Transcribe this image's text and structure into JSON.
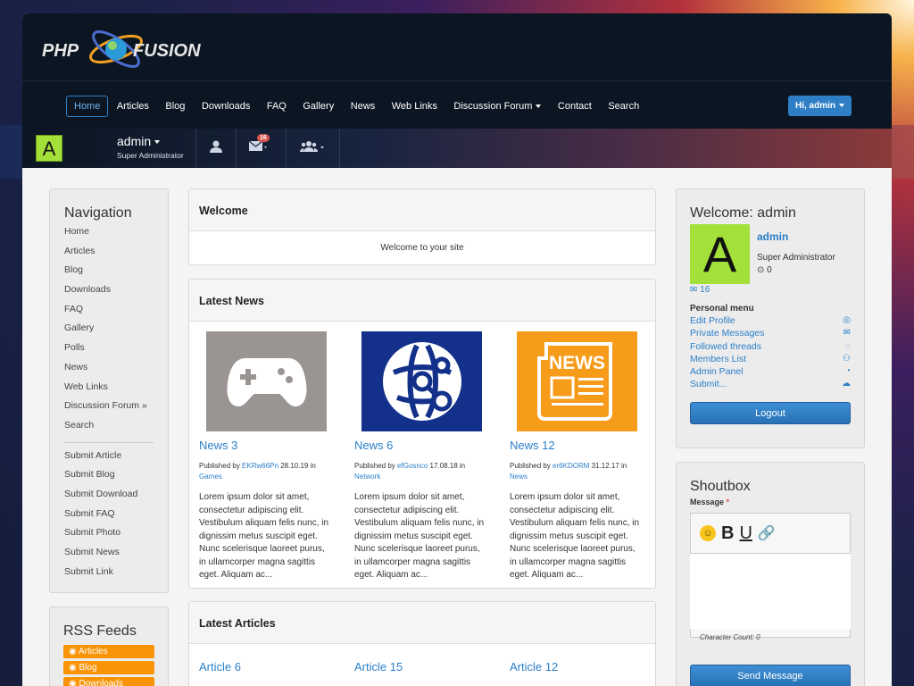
{
  "brand": {
    "logo_text": "PHP FUSION",
    "accent": "#2a7fc9",
    "avatar_color": "#a3e03a"
  },
  "topnav": {
    "items": [
      "Home",
      "Articles",
      "Blog",
      "Downloads",
      "FAQ",
      "Gallery",
      "News",
      "Web Links",
      "Discussion Forum",
      "Contact",
      "Search"
    ],
    "active": "Home",
    "user_button": "Hi, admin"
  },
  "userbar": {
    "avatar_letter": "A",
    "name": "admin",
    "role": "Super Administrator",
    "messages_count": "16"
  },
  "navigation": {
    "title": "Navigation",
    "items": [
      "Home",
      "Articles",
      "Blog",
      "Downloads",
      "FAQ",
      "Gallery",
      "Polls",
      "News",
      "Web Links",
      "Discussion Forum »",
      "Search"
    ],
    "submit_items": [
      "Submit Article",
      "Submit Blog",
      "Submit Download",
      "Submit FAQ",
      "Submit Photo",
      "Submit News",
      "Submit Link"
    ]
  },
  "rss": {
    "title": "RSS Feeds",
    "items": [
      "Articles",
      "Blog",
      "Downloads"
    ]
  },
  "welcome_panel": {
    "title": "Welcome",
    "text": "Welcome to your site"
  },
  "latest_news": {
    "title": "Latest News",
    "items": [
      {
        "title": "News 3",
        "published_by": "Published by",
        "author": "EKRw66Pn",
        "date": "28.10.19",
        "in": "in",
        "category": "Games",
        "icon": "gamepad-icon",
        "body": "Lorem ipsum dolor sit amet, consectetur adipiscing elit. Vestibulum aliquam felis nunc, in dignissim metus suscipit eget. Nunc scelerisque laoreet purus, in ullamcorper magna sagittis eget. Aliquam ac..."
      },
      {
        "title": "News 6",
        "published_by": "Published by",
        "author": "efGosnco",
        "date": "17.08.18",
        "in": "in",
        "category": "Network",
        "icon": "network-globe-icon",
        "body": "Lorem ipsum dolor sit amet, consectetur adipiscing elit. Vestibulum aliquam felis nunc, in dignissim metus suscipit eget. Nunc scelerisque laoreet purus, in ullamcorper magna sagittis eget. Aliquam ac..."
      },
      {
        "title": "News 12",
        "published_by": "Published by",
        "author": "er6KDORM",
        "date": "31.12.17",
        "in": "in",
        "category": "News",
        "icon": "newspaper-icon",
        "body": "Lorem ipsum dolor sit amet, consectetur adipiscing elit. Vestibulum aliquam felis nunc, in dignissim metus suscipit eget. Nunc scelerisque laoreet purus, in ullamcorper magna sagittis eget. Aliquam ac..."
      }
    ]
  },
  "latest_articles": {
    "title": "Latest Articles",
    "items": [
      "Article 6",
      "Article 15",
      "Article 12"
    ]
  },
  "user_panel": {
    "title": "Welcome: admin",
    "avatar_letter": "A",
    "name": "admin",
    "role": "Super Administrator",
    "points": "0",
    "messages": "16",
    "personal_menu_title": "Personal menu",
    "menu": [
      "Edit Profile",
      "Private Messages",
      "Followed threads",
      "Members List",
      "Admin Panel",
      "Submit..."
    ],
    "logout": "Logout"
  },
  "shoutbox": {
    "title": "Shoutbox",
    "message_label": "Message",
    "required_mark": "*",
    "char_count": "Character Count: 0",
    "send": "Send Message"
  }
}
